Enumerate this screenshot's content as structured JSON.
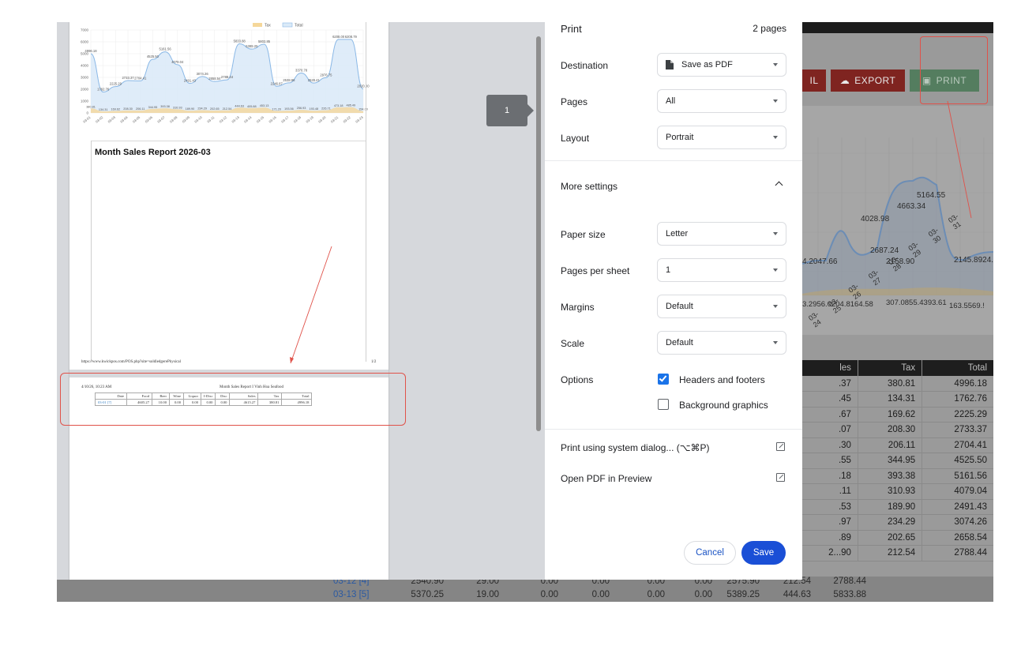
{
  "colors": {
    "accent": "#1a73e8",
    "save_button": "#1a4fd6",
    "annotation": "#e0524a",
    "tax_series": "#f5d79a",
    "total_series": "#8ab8e6"
  },
  "print": {
    "title": "Print",
    "page_count": "2 pages",
    "destination": {
      "label": "Destination",
      "value": "Save as PDF",
      "icon": "document-icon"
    },
    "pages": {
      "label": "Pages",
      "value": "All"
    },
    "layout": {
      "label": "Layout",
      "value": "Portrait"
    },
    "more_settings": "More settings",
    "paper_size": {
      "label": "Paper size",
      "value": "Letter"
    },
    "pages_per_sheet": {
      "label": "Pages per sheet",
      "value": "1"
    },
    "margins": {
      "label": "Margins",
      "value": "Default"
    },
    "scale": {
      "label": "Scale",
      "value": "Default"
    },
    "options": {
      "label": "Options",
      "headers_footers": "Headers and footers",
      "headers_footers_checked": true,
      "background_graphics": "Background graphics",
      "background_graphics_checked": false
    },
    "system_dialog": "Print using system dialog... (⌥⌘P)",
    "open_pdf": "Open PDF in Preview",
    "cancel": "Cancel",
    "save": "Save"
  },
  "preview": {
    "page_badge": "1",
    "report_title": "Month Sales Report 2026-03",
    "footer_url": "https://www.kwickpos.com/POS.php?site=soldledgerePhysical",
    "footer_page": "1/2",
    "page2_datetime": "4/10/26, 10:23 AM",
    "page2_title": "Month Sales Report I Vinh Hoa Seafood",
    "mini_table": {
      "headers": [
        "Date",
        "Food",
        "Beer",
        "Wine",
        "Liquor",
        "I-Disc",
        "Disc",
        "Sales",
        "Tax",
        "Total"
      ],
      "row": [
        "03-01 [7]",
        "4605.27",
        "10.00",
        "0.00",
        "0.00",
        "0.00",
        "0.00",
        "4615.27",
        "380.81",
        "4996.18"
      ]
    }
  },
  "chart_data": {
    "type": "area",
    "legend": [
      "Tax",
      "Total"
    ],
    "legend_position": "top",
    "y_ticks": [
      "0",
      "1000",
      "2000",
      "3000",
      "4000",
      "5000",
      "6000",
      "7000"
    ],
    "ylim": [
      0,
      7000
    ],
    "categories": [
      "03-01",
      "03-02",
      "03-03",
      "03-04",
      "03-05",
      "03-06",
      "03-07",
      "03-08",
      "03-09",
      "03-10",
      "03-11",
      "03-12",
      "03-13",
      "03-14",
      "03-15",
      "03-16",
      "03-17",
      "03-18",
      "03-19",
      "03-20",
      "03-21",
      "03-22",
      "03-23"
    ],
    "series": [
      {
        "name": "Total",
        "values": [
          4996.18,
          1762.76,
          2225.29,
          2733.37,
          2704.41,
          4525.5,
          5161.56,
          4079.04,
          2491.43,
          3074.26,
          2658.54,
          2788.44,
          5833.88,
          5389.25,
          5802.85,
          2246.87,
          2538.96,
          3370.78,
          2528.41,
          2976.75,
          6208.0,
          6208.79,
          2020.0
        ]
      },
      {
        "name": "Tax",
        "values": [
          380.81,
          134.31,
          169.62,
          208.3,
          206.11,
          344.95,
          393.38,
          310.93,
          189.9,
          234.29,
          202.65,
          212.54,
          444.63,
          405.88,
          453.13,
          171.2,
          193.56,
          256.93,
          193.48,
          226.71,
          473.18,
          485.49,
          154.0
        ]
      }
    ]
  },
  "background": {
    "buttons": {
      "email_partial": "IL",
      "export": "EXPORT",
      "print": "PRINT"
    },
    "chart_labels": [
      "5164.55",
      "4663.34",
      "4028.98",
      "2687.24",
      "4.2047.66",
      "2158.90",
      "2145.8924.",
      "3.2956.0204.8164.58",
      "307.0855.4393.61",
      "163.5569.!"
    ],
    "chart_ticks": [
      "03-24",
      "03-25",
      "03-26",
      "03-27",
      "03-28",
      "03-29",
      "03-30",
      "03-31"
    ],
    "table": {
      "headers": [
        "les",
        "Tax",
        "Total"
      ],
      "rows": [
        [
          ".37",
          "380.81",
          "4996.18"
        ],
        [
          ".45",
          "134.31",
          "1762.76"
        ],
        [
          ".67",
          "169.62",
          "2225.29"
        ],
        [
          ".07",
          "208.30",
          "2733.37"
        ],
        [
          ".30",
          "206.11",
          "2704.41"
        ],
        [
          ".55",
          "344.95",
          "4525.50"
        ],
        [
          ".18",
          "393.38",
          "5161.56"
        ],
        [
          ".11",
          "310.93",
          "4079.04"
        ],
        [
          ".53",
          "189.90",
          "2491.43"
        ],
        [
          ".97",
          "234.29",
          "3074.26"
        ],
        [
          ".89",
          "202.65",
          "2658.54"
        ],
        [
          "2...90",
          "212.54",
          "2788.44"
        ]
      ]
    },
    "bottom_rows": [
      [
        "03-12 [4]",
        "2540.90",
        "29.00",
        "0.00",
        "0.00",
        "0.00",
        "0.00",
        "2575.90",
        "212.54",
        "2788.44"
      ],
      [
        "03-13 [5]",
        "5370.25",
        "19.00",
        "0.00",
        "0.00",
        "0.00",
        "0.00",
        "5389.25",
        "444.63",
        "5833.88"
      ]
    ]
  }
}
